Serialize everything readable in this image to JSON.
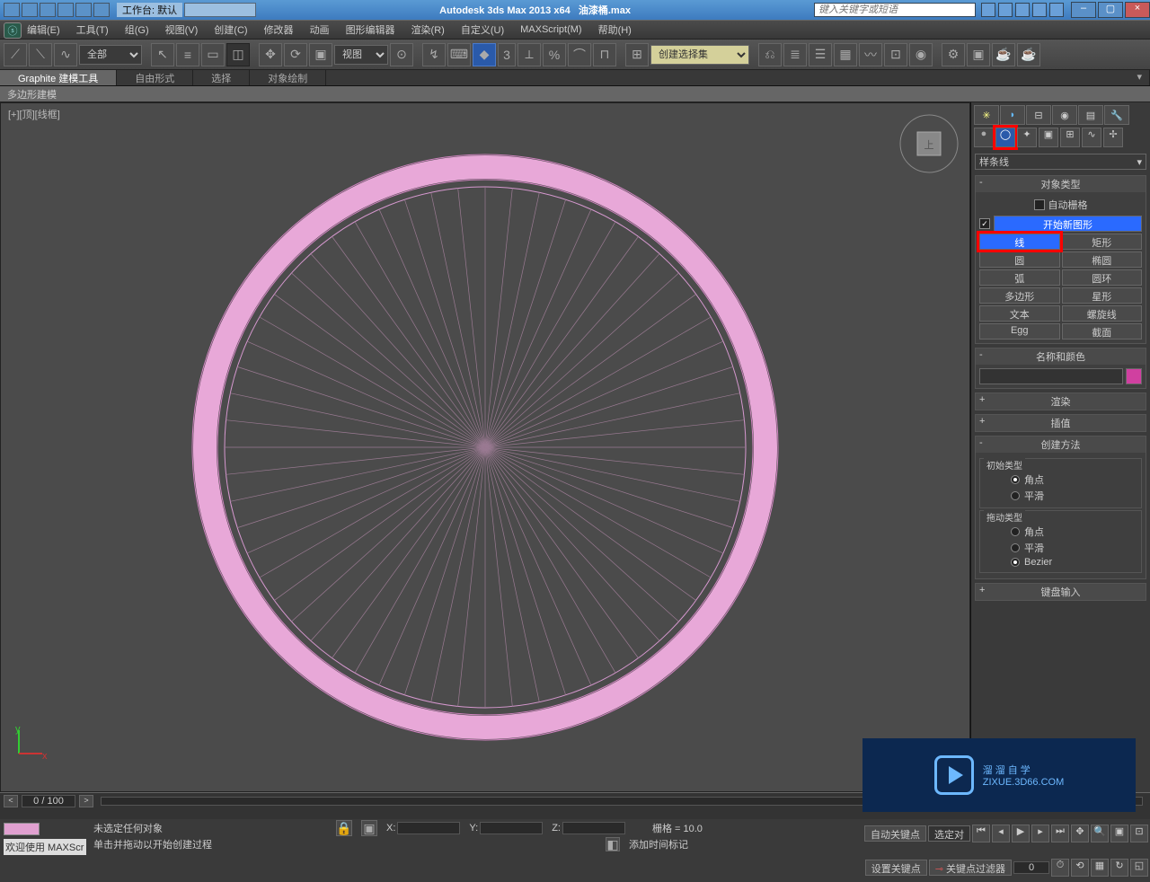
{
  "title": {
    "app": "Autodesk 3ds Max  2013 x64",
    "file": "油漆桶.max",
    "workspace_label": "工作台: 默认",
    "search_placeholder": "键入关键字或短语",
    "window_min": "–",
    "window_max": "▢",
    "window_close": "×"
  },
  "menu": {
    "edit": "编辑(E)",
    "tools": "工具(T)",
    "group": "组(G)",
    "views": "视图(V)",
    "create": "创建(C)",
    "modifiers": "修改器",
    "animation": "动画",
    "grapheditors": "图形编辑器",
    "rendering": "渲染(R)",
    "customize": "自定义(U)",
    "maxscript": "MAXScript(M)",
    "help": "帮助(H)"
  },
  "toolbar": {
    "all": "全部",
    "viewlabel": "视图",
    "selectset": "创建选择集"
  },
  "ribbon": {
    "tab1": "Graphite 建模工具",
    "tab2": "自由形式",
    "tab3": "选择",
    "tab4": "对象绘制",
    "sub": "多边形建模"
  },
  "viewport": {
    "label": "[+][顶][线框]"
  },
  "panel": {
    "dropdown": "样条线",
    "roll_objtype": "对象类型",
    "autogrid": "自动栅格",
    "startnew": "开始新图形",
    "btn_line": "线",
    "btn_rect": "矩形",
    "btn_circle": "圆",
    "btn_ellipse": "椭圆",
    "btn_arc": "弧",
    "btn_donut": "圆环",
    "btn_ngon": "多边形",
    "btn_star": "星形",
    "btn_text": "文本",
    "btn_helix": "螺旋线",
    "btn_egg": "Egg",
    "btn_section": "截面",
    "roll_name": "名称和颜色",
    "roll_render": "渲染",
    "roll_interp": "插值",
    "roll_method": "创建方法",
    "grp_initial": "初始类型",
    "grp_drag": "拖动类型",
    "opt_corner": "角点",
    "opt_smooth": "平滑",
    "opt_bezier": "Bezier",
    "roll_keyboard": "键盘输入"
  },
  "timeline": {
    "frame": "0 / 100"
  },
  "status": {
    "welcome": "欢迎使用  MAXScr",
    "noselect": "未选定任何对象",
    "prompt": "单击并拖动以开始创建过程",
    "x": "X:",
    "y": "Y:",
    "z": "Z:",
    "grid": "栅格 = 10.0",
    "addmarker": "添加时间标记",
    "autokey": "自动关键点",
    "setkey": "设置关键点",
    "selected_label": "选定对",
    "keyfilter": "关键点过滤器"
  },
  "watermark": {
    "text": "溜溜自学",
    "url": "ZIXUE.3D66.COM"
  }
}
